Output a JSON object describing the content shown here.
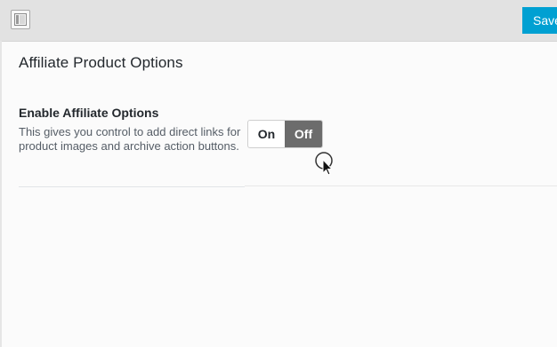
{
  "toolbar": {
    "panel_icon": "sidebar-panel-icon",
    "save_label": "Save",
    "save_color": "#00a0d2"
  },
  "section": {
    "title": "Affiliate Product Options"
  },
  "option": {
    "label": "Enable Affiliate Options",
    "description": "This gives you control to add direct links for product images and archive action buttons.",
    "toggle": {
      "on_label": "On",
      "off_label": "Off",
      "selected": "Off",
      "active_color": "#6c6c6c"
    }
  },
  "cursor": {
    "icon": "click-pointer-icon"
  }
}
